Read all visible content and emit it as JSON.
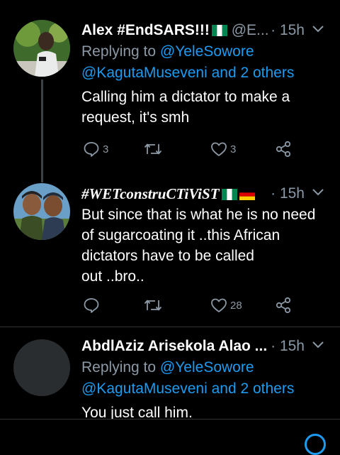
{
  "tweets": [
    {
      "name": "Alex #EndSARS!!!",
      "handle": "@E...",
      "time": "· 15h",
      "replying_prefix": "Replying to ",
      "replying_user": "@YeleSowore",
      "replying_line2": "@KagutaMuseveni and 2 others",
      "body": [
        "Calling him a dictator to make a",
        "request, it's smh"
      ],
      "replies": "3",
      "retweets": "",
      "likes": "3"
    },
    {
      "name": "#WETconstruCTiViST",
      "time": "· 15h",
      "body": [
        "But since that is what he is no need",
        "of sugarcoating it ..this African",
        "dictators have to be called",
        "out ..bro.."
      ],
      "replies": "",
      "retweets": "",
      "likes": "28"
    },
    {
      "name": "AbdlAziz Arisekola Alao ...",
      "time": "· 15h",
      "replying_prefix": "Replying to ",
      "replying_user": "@YeleSowore",
      "replying_line2": "@KagutaMuseveni and 2 others",
      "body": [
        "You just call him."
      ]
    }
  ],
  "colors": {
    "background": "#000000",
    "muted": "#8b98a5",
    "link": "#1d9bf0",
    "thread_line": "#3d4144"
  }
}
